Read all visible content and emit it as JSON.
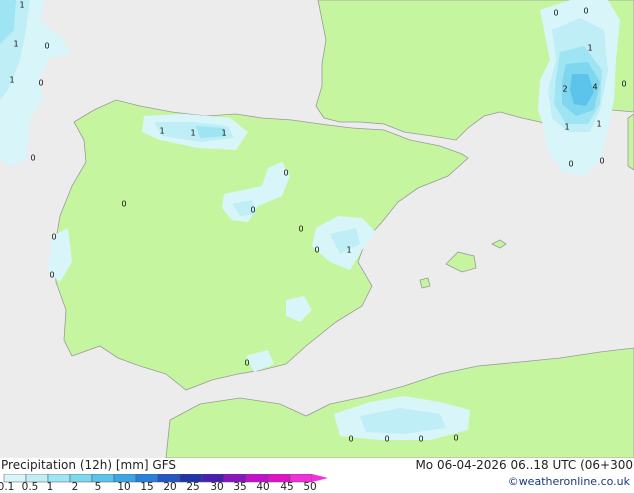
{
  "footer": {
    "title": "Precipitation (12h) [mm] GFS",
    "time": "Mo 06-04-2026 06..18 UTC (06+300",
    "credit": "©weatheronline.co.uk"
  },
  "legend": {
    "ticks": [
      "0.1",
      "0.5",
      "1",
      "2",
      "5",
      "10",
      "15",
      "20",
      "25",
      "30",
      "35",
      "40",
      "45",
      "50"
    ],
    "colors": [
      "#d8f6fa",
      "#bfeef6",
      "#9fe4f2",
      "#7ed6ef",
      "#5cc3ea",
      "#3ba6e3",
      "#2a7fd8",
      "#2456c4",
      "#2233a8",
      "#4a1fb0",
      "#8a16c2",
      "#c410cc",
      "#e012c8",
      "#f030d8"
    ]
  },
  "map": {
    "land_color": "#c6f5a0",
    "sea_color": "#ececec",
    "border_color": "#9a9a9a",
    "point_labels": [
      "1",
      "1",
      "0",
      "1",
      "0",
      "0",
      "0",
      "1",
      "1",
      "1",
      "0",
      "0",
      "0",
      "0",
      "0",
      "0",
      "0",
      "1",
      "0",
      "0",
      "0",
      "0",
      "0",
      "0",
      "1",
      "2",
      "4",
      "0",
      "1",
      "1",
      "0",
      "0"
    ]
  }
}
